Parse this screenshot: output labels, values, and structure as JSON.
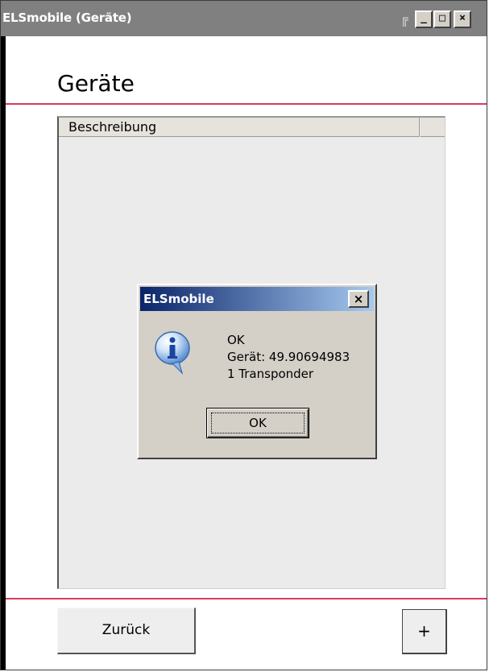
{
  "window": {
    "title": "ELSmobile (Geräte)",
    "buttons": {
      "minimize": "_",
      "maximize": "□",
      "close": "×"
    }
  },
  "page": {
    "title": "Geräte"
  },
  "list": {
    "columns": [
      "Beschreibung"
    ],
    "rows": []
  },
  "dialog": {
    "title": "ELSmobile",
    "close_label": "×",
    "icon": "info-icon",
    "message_lines": [
      "OK",
      "Gerät: 49.90694983",
      "1 Transponder"
    ],
    "ok_label": "OK"
  },
  "footer": {
    "back_label": "Zurück",
    "add_label": "+"
  },
  "colors": {
    "accent_line": "#d83b5a",
    "titlebar_inactive": "#808080",
    "dialog_title_start": "#0a246a",
    "dialog_title_end": "#a6caf0"
  }
}
